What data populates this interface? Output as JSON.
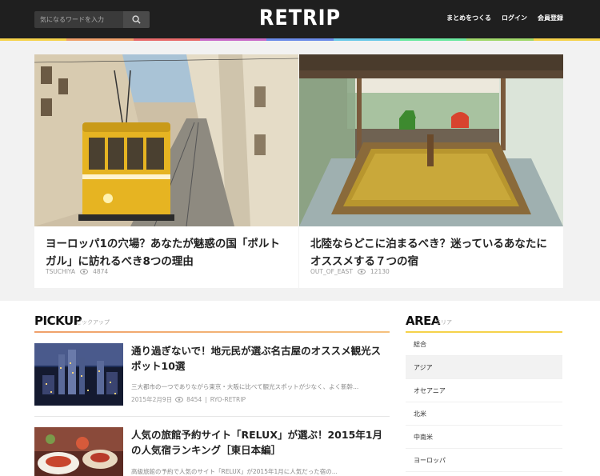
{
  "header": {
    "search_placeholder": "気になるワードを入力",
    "logo": "RETRIP",
    "nav": [
      "まとめをつくる",
      "ログイン",
      "会員登録"
    ],
    "strip_colors": [
      "#f5d24a",
      "#f0a06a",
      "#e86a6a",
      "#c86ac8",
      "#6a8ae8",
      "#6ac8e8",
      "#6ae8a0",
      "#a0d86a",
      "#f5d24a"
    ]
  },
  "hero": [
    {
      "title": "ヨーロッパ1の穴場？あなたが魅惑の国「ポルトガル」に訪れるべき8つの理由",
      "author": "TSUCHIYA",
      "views": "4874"
    },
    {
      "title": "北陸ならどこに泊まるべき？迷っているあなたにオススメする７つの宿",
      "author": "OUT_OF_EAST",
      "views": "12130"
    }
  ],
  "pickup": {
    "title": "PICKUP",
    "subtitle": "ピックアップ",
    "articles": [
      {
        "title": "通り過ぎないで！地元民が選ぶ名古屋のオススメ観光スポット10選",
        "desc": "三大都市の一つでありながら東京・大阪に比べて観光スポットが少なく、よく新幹...",
        "date": "2015年2月9日",
        "views": "8454",
        "author": "RYO-RETRIP"
      },
      {
        "title": "人気の旅館予約サイト「RELUX」が選ぶ！2015年1月の人気宿ランキング［東日本編］",
        "desc": "高級旅館の予約で人気のサイト「RELUX」が2015年1月に人気だった宿の..."
      }
    ]
  },
  "area": {
    "title": "AREA",
    "subtitle": "エリア",
    "items": [
      "総合",
      "アジア",
      "オセアニア",
      "北米",
      "中南米",
      "ヨーロッパ"
    ]
  }
}
